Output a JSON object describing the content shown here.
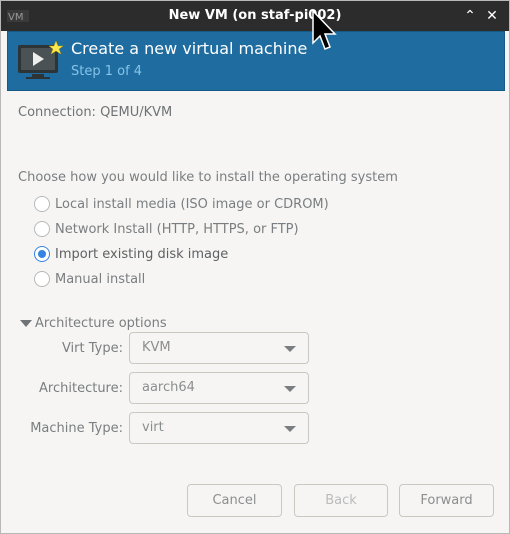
{
  "window": {
    "title": "New VM (on staf-pi002)",
    "minimize_icon": "chevron-up-icon",
    "close_icon": "close-icon"
  },
  "banner": {
    "title": "Create a new virtual machine",
    "step": "Step 1 of 4",
    "icon": "vm-monitor-icon"
  },
  "connection": {
    "text": "Connection:  QEMU/KVM"
  },
  "install": {
    "heading": "Choose how you would like to install the operating system",
    "options": [
      {
        "label": "Local install media (ISO image or CDROM)",
        "checked": false
      },
      {
        "label": "Network Install (HTTP, HTTPS, or FTP)",
        "checked": false
      },
      {
        "label": "Import existing disk image",
        "checked": true
      },
      {
        "label": "Manual install",
        "checked": false
      }
    ]
  },
  "arch": {
    "expander_label": "Architecture options",
    "virt_type_label": "Virt Type:",
    "virt_type_value": "KVM",
    "architecture_label": "Architecture:",
    "architecture_value": "aarch64",
    "machine_type_label": "Machine Type:",
    "machine_type_value": "virt"
  },
  "buttons": {
    "cancel": "Cancel",
    "back": "Back",
    "forward": "Forward"
  },
  "colors": {
    "banner": "#1e6ca0",
    "radio_accent": "#3584e4",
    "titlebar": "#2c2c2c"
  }
}
